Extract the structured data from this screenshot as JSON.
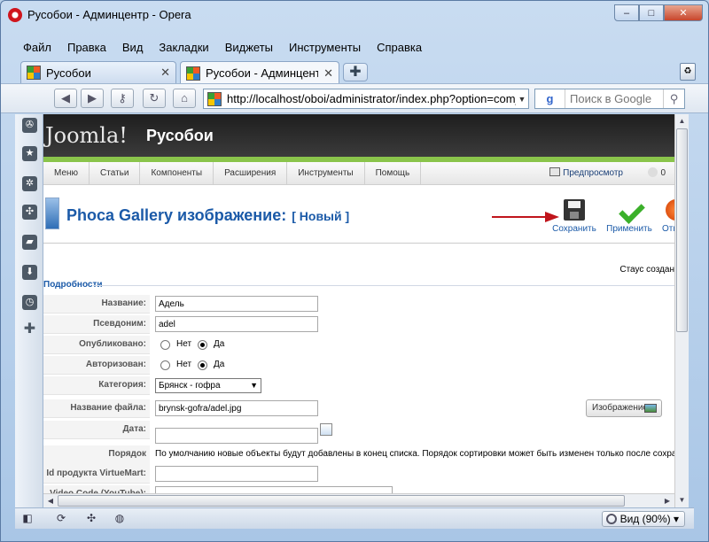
{
  "window": {
    "title": "Русобои - Админцентр - Opera",
    "min": "–",
    "max": "□",
    "close": "✕"
  },
  "menu": [
    "Файл",
    "Правка",
    "Вид",
    "Закладки",
    "Виджеты",
    "Инструменты",
    "Справка"
  ],
  "tabs": [
    {
      "label": "Русобои",
      "close": "✕"
    },
    {
      "label": "Русобои - Админцентр",
      "close": "✕"
    }
  ],
  "newtab": "✚",
  "toolbar": {
    "back": "◀",
    "forward": "▶",
    "key": "⚷",
    "reload": "↻",
    "home": "⌂",
    "url": "http://localhost/oboi/administrator/index.php?option=com_phocagallery",
    "search_engine": "g",
    "search_placeholder": "Поиск в Google",
    "search_btn": "⚲"
  },
  "panel_icons": [
    "✇",
    "★",
    "✲",
    "✣",
    "▰",
    "⬇",
    "◷",
    "✚"
  ],
  "joomla": {
    "logo": "Joomla!",
    "site_name": "Русобои",
    "admin_menu": [
      "Меню",
      "Статьи",
      "Компоненты",
      "Расширения",
      "Инструменты",
      "Помощь"
    ],
    "preview": "Предпросмотр",
    "msg_count": "0"
  },
  "page": {
    "heading": "Phoca Gallery изображение:",
    "sub": "[ Новый ]",
    "buttons": [
      {
        "label": "Сохранить"
      },
      {
        "label": "Применить"
      },
      {
        "label": "Отмена"
      }
    ],
    "status_text": "Стаус создан",
    "legend": "Подробности"
  },
  "form": {
    "name_label": "Название:",
    "name_value": "Адель",
    "alias_label": "Псевдоним:",
    "alias_value": "adel",
    "published_label": "Опубликовано:",
    "approved_label": "Авторизован:",
    "no": "Нет",
    "yes": "Да",
    "category_label": "Категория:",
    "category_value": "Брянск - гофра",
    "filename_label": "Название файла:",
    "filename_value": "brynsk-gofra/adel.jpg",
    "image_btn": "Изображение",
    "date_label": "Дата:",
    "date_value": "",
    "ordering_label": "Порядок расположения:",
    "ordering_text": "По умолчанию новые объекты будут добавлены в конец списка. Порядок сортировки может быть изменен только после сохранения",
    "vm_label": "Id продукта VirtueMart:",
    "vm_value": "",
    "yt_label": "Video Code (YouTube):"
  },
  "statusbar": {
    "zoom": "Вид (90%)",
    "zoom_caret": "▾"
  }
}
